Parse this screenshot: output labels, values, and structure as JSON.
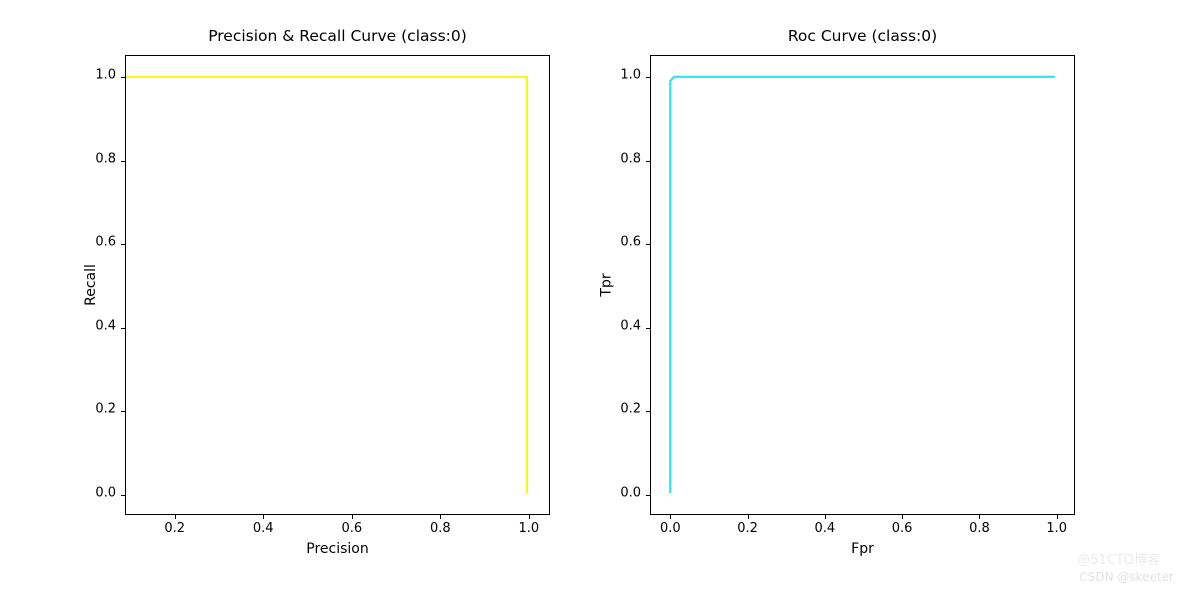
{
  "chart_data": [
    {
      "type": "line",
      "title": "Precision & Recall Curve (class:0)",
      "xlabel": "Precision",
      "ylabel": "Recall",
      "x": [
        0.09,
        1.0,
        1.0
      ],
      "y": [
        1.0,
        1.0,
        0.0
      ],
      "xlim": [
        0.09,
        1.05
      ],
      "ylim": [
        -0.05,
        1.05
      ],
      "xticks": [
        0.2,
        0.4,
        0.6,
        0.8,
        1.0
      ],
      "yticks": [
        0.0,
        0.2,
        0.4,
        0.6,
        0.8,
        1.0
      ],
      "color": "#f7f71a"
    },
    {
      "type": "line",
      "title": "Roc Curve (class:0)",
      "xlabel": "Fpr",
      "ylabel": "Tpr",
      "x": [
        0.0,
        0.0,
        0.01,
        1.0
      ],
      "y": [
        0.0,
        0.99,
        1.0,
        1.0
      ],
      "xlim": [
        -0.05,
        1.05
      ],
      "ylim": [
        -0.05,
        1.05
      ],
      "xticks": [
        0.0,
        0.2,
        0.4,
        0.6,
        0.8,
        1.0
      ],
      "yticks": [
        0.0,
        0.2,
        0.4,
        0.6,
        0.8,
        1.0
      ],
      "color": "#2ae8e8"
    }
  ],
  "watermark1": "CSDN @skeeter",
  "watermark2": "@51CTO博客"
}
